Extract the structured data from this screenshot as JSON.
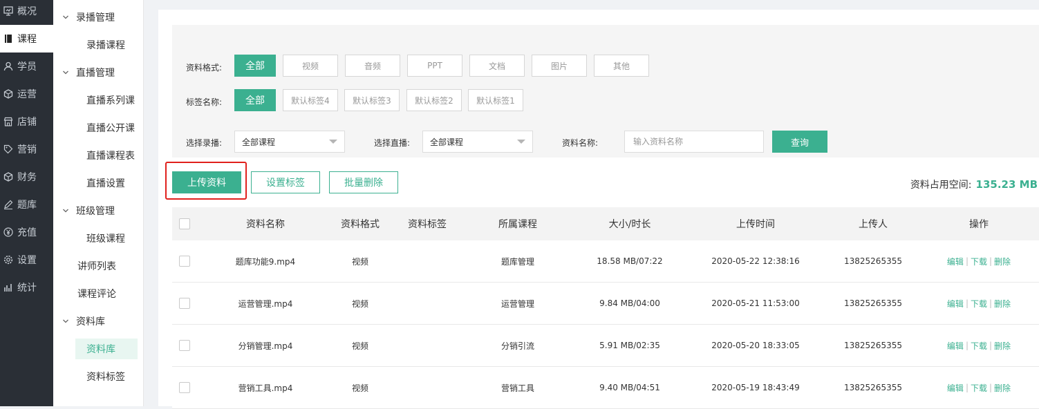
{
  "nav": [
    {
      "label": "概况",
      "icon": "overview-icon"
    },
    {
      "label": "课程",
      "icon": "book-icon",
      "active": true
    },
    {
      "label": "学员",
      "icon": "user-icon"
    },
    {
      "label": "运营",
      "icon": "cube-icon"
    },
    {
      "label": "店铺",
      "icon": "shop-icon"
    },
    {
      "label": "营销",
      "icon": "tag-icon"
    },
    {
      "label": "财务",
      "icon": "finance-icon"
    },
    {
      "label": "题库",
      "icon": "pen-icon"
    },
    {
      "label": "充值",
      "icon": "yen-icon"
    },
    {
      "label": "设置",
      "icon": "gear-icon"
    },
    {
      "label": "统计",
      "icon": "chart-icon"
    }
  ],
  "submenu": {
    "recorded_group": "录播管理",
    "recorded_course": "录播课程",
    "live_group": "直播管理",
    "live_series": "直播系列课",
    "live_public": "直播公开课",
    "live_schedule": "直播课程表",
    "live_settings": "直播设置",
    "class_group": "班级管理",
    "class_course": "班级课程",
    "teacher_list": "讲师列表",
    "course_review": "课程评论",
    "library_group": "资料库",
    "library": "资料库",
    "library_tags": "资料标签"
  },
  "filter": {
    "format_label": "资料格式:",
    "formats": [
      "全部",
      "视频",
      "音频",
      "PPT",
      "文档",
      "图片",
      "其他"
    ],
    "tag_label": "标签名称:",
    "tags": [
      "全部",
      "默认标签4",
      "默认标签3",
      "默认标签2",
      "默认标签1"
    ],
    "recorded_label": "选择录播:",
    "recorded_value": "全部课程",
    "live_label": "选择直播:",
    "live_value": "全部课程",
    "name_label": "资料名称:",
    "name_placeholder": "输入资料名称",
    "query_label": "查询"
  },
  "actions": {
    "upload": "上传资料",
    "set_tags": "设置标签",
    "batch_delete": "批量删除"
  },
  "storage": {
    "label": "资料占用空间:",
    "value": "135.23 MB"
  },
  "table": {
    "headers": [
      "资料名称",
      "资料格式",
      "资料标签",
      "所属课程",
      "大小/时长",
      "上传时间",
      "上传人",
      "操作"
    ],
    "rows": [
      {
        "name": "题库功能9.mp4",
        "format": "视频",
        "tag": "",
        "course": "题库管理",
        "size": "18.58 MB/07:22",
        "time": "2020-05-22 12:38:16",
        "uploader": "13825265355"
      },
      {
        "name": "运营管理.mp4",
        "format": "视频",
        "tag": "",
        "course": "运营管理",
        "size": "9.84 MB/04:00",
        "time": "2020-05-21 11:53:00",
        "uploader": "13825265355"
      },
      {
        "name": "分销管理.mp4",
        "format": "视频",
        "tag": "",
        "course": "分销引流",
        "size": "5.91 MB/02:35",
        "time": "2020-05-20 18:33:05",
        "uploader": "13825265355"
      },
      {
        "name": "营销工具.mp4",
        "format": "视频",
        "tag": "",
        "course": "营销工具",
        "size": "9.40 MB/04:51",
        "time": "2020-05-19 18:43:49",
        "uploader": "13825265355"
      }
    ],
    "ops": {
      "edit": "编辑",
      "download": "下载",
      "delete": "删除",
      "sep": "|"
    }
  }
}
